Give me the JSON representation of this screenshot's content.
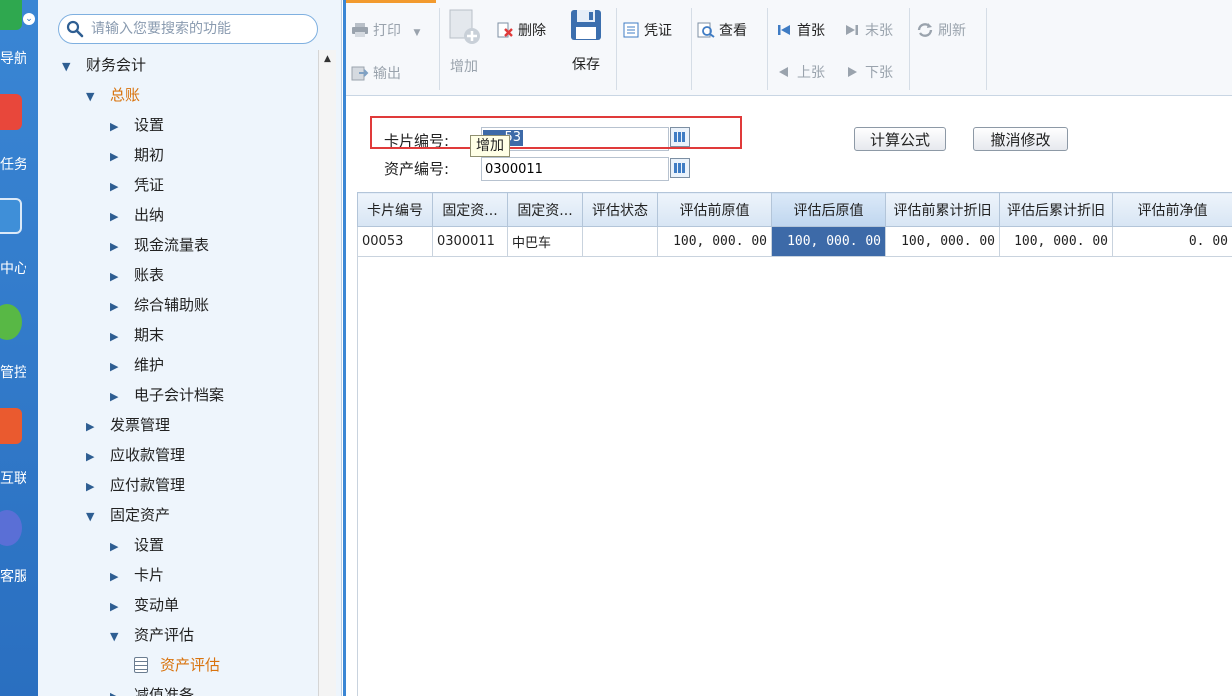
{
  "rail": {
    "items": [
      {
        "label": "导航",
        "icon": "navigation-icon",
        "color": "#2fa84f"
      },
      {
        "label": "任务",
        "icon": "task-icon",
        "color": "#e8473b"
      },
      {
        "label": "中心",
        "icon": "document-center-icon",
        "color": "#3f8fd8"
      },
      {
        "label": "管控",
        "icon": "control-icon",
        "color": "#58b845"
      },
      {
        "label": "互联",
        "icon": "connect-icon",
        "color": "#ea5a2f"
      },
      {
        "label": "客服",
        "icon": "service-icon",
        "color": "#5a6fd6"
      }
    ]
  },
  "search": {
    "placeholder": "请输入您要搜索的功能"
  },
  "tree": {
    "items": [
      {
        "label": "财务会计",
        "level": 0,
        "state": "open"
      },
      {
        "label": "总账",
        "level": 1,
        "state": "open",
        "active": true
      },
      {
        "label": "设置",
        "level": 2,
        "state": "closed"
      },
      {
        "label": "期初",
        "level": 2,
        "state": "closed"
      },
      {
        "label": "凭证",
        "level": 2,
        "state": "closed"
      },
      {
        "label": "出纳",
        "level": 2,
        "state": "closed"
      },
      {
        "label": "现金流量表",
        "level": 2,
        "state": "closed"
      },
      {
        "label": "账表",
        "level": 2,
        "state": "closed"
      },
      {
        "label": "综合辅助账",
        "level": 2,
        "state": "closed"
      },
      {
        "label": "期末",
        "level": 2,
        "state": "closed"
      },
      {
        "label": "维护",
        "level": 2,
        "state": "closed"
      },
      {
        "label": "电子会计档案",
        "level": 2,
        "state": "closed"
      },
      {
        "label": "发票管理",
        "level": 1,
        "state": "closed"
      },
      {
        "label": "应收款管理",
        "level": 1,
        "state": "closed"
      },
      {
        "label": "应付款管理",
        "level": 1,
        "state": "closed"
      },
      {
        "label": "固定资产",
        "level": 1,
        "state": "open"
      },
      {
        "label": "设置",
        "level": 2,
        "state": "closed"
      },
      {
        "label": "卡片",
        "level": 2,
        "state": "closed"
      },
      {
        "label": "变动单",
        "level": 2,
        "state": "closed"
      },
      {
        "label": "资产评估",
        "level": 2,
        "state": "open"
      },
      {
        "label": "资产评估",
        "level": 3,
        "state": "leaf",
        "active": true
      },
      {
        "label": "减值准备",
        "level": 2,
        "state": "closed"
      }
    ]
  },
  "toolbar": {
    "print": "打印",
    "export": "输出",
    "add": "增加",
    "delete": "删除",
    "save": "保存",
    "voucher": "凭证",
    "view": "查看",
    "first": "首张",
    "last": "末张",
    "prev": "上张",
    "next": "下张",
    "refresh": "刷新"
  },
  "form": {
    "card_no_label": "卡片编号:",
    "card_no_value": "53",
    "asset_no_label": "资产编号:",
    "asset_no_value": "0300011",
    "formula_button": "计算公式",
    "undo_button": "撤消修改",
    "tooltip": "增加"
  },
  "grid": {
    "columns": [
      "卡片编号",
      "固定资...",
      "固定资...",
      "评估状态",
      "评估前原值",
      "评估后原值",
      "评估前累计折旧",
      "评估后累计折旧",
      "评估前净值"
    ],
    "rows": [
      [
        "00053",
        "0300011",
        "中巴车",
        "",
        "100, 000. 00",
        "100, 000. 00",
        "100, 000. 00",
        "100, 000. 00",
        "0. 00"
      ]
    ]
  },
  "colors": {
    "accent": "#3a86d4",
    "selection": "#3d6aa8",
    "active_text": "#d9730d",
    "highlight_box": "#e03a3a"
  }
}
